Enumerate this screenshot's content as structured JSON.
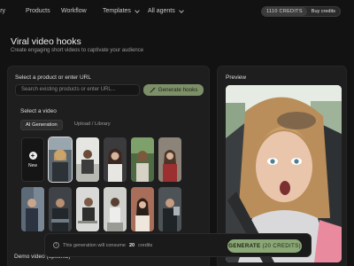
{
  "nav": {
    "items": [
      "rary",
      "Products",
      "Workflow",
      "Templates",
      "All agents"
    ],
    "credits": "1110 CREDITS",
    "buy": "Buy credits"
  },
  "header": {
    "title": "Viral video hooks",
    "subtitle": "Create engaging short videos to captivate your audience"
  },
  "left": {
    "select_product_label": "Select a product or enter URL",
    "url_placeholder": "Search existing products or enter URL...",
    "generate_hooks": "Generate hooks",
    "select_video_label": "Select a video",
    "tabs": [
      "AI Generation",
      "Upload / Library"
    ],
    "new_label": "New",
    "demo_label": "Demo video (optional)"
  },
  "right": {
    "preview_label": "Preview"
  },
  "footer": {
    "msg_prefix": "This generation will consume",
    "msg_count": "20",
    "msg_suffix": "credits",
    "generate": "GENERATE",
    "generate_credits": "(20 CREDITS)"
  },
  "colors": {
    "accent": "#8ca777",
    "bg": "#121212",
    "panel": "#1e1e1e"
  }
}
